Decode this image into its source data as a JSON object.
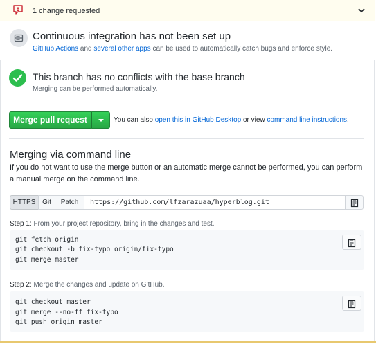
{
  "review_bar": {
    "icon": "review-request-icon",
    "text": "1 change requested",
    "chevron": "chevron-down-icon"
  },
  "ci": {
    "icon": "server-icon",
    "title": "Continuous integration has not been set up",
    "link1": "GitHub Actions",
    "mid1": " and ",
    "link2": "several other apps",
    "rest": " can be used to automatically catch bugs and enforce style."
  },
  "conflicts": {
    "icon": "check-icon",
    "title": "This branch has no conflicts with the base branch",
    "desc": "Merging can be performed automatically."
  },
  "merge": {
    "button_label": "Merge pull request",
    "caret": "caret-down-icon",
    "also_prefix": "You can also ",
    "desktop_link": "open this in GitHub Desktop",
    "or_view": " or view ",
    "cli_link": "command line instructions",
    "period": "."
  },
  "cli": {
    "title": "Merging via command line",
    "desc": "If you do not want to use the merge button or an automatic merge cannot be performed, you can perform a manual merge on the command line.",
    "protocols": [
      "HTTPS",
      "Git",
      "Patch"
    ],
    "selected_protocol": "HTTPS",
    "clone_url": "https://github.com/lfzarazuaa/hyperblog.git",
    "step1_label": "Step 1:",
    "step1_text": " From your project repository, bring in the changes and test.",
    "step1_code": [
      "git fetch origin",
      "git checkout -b fix-typo origin/fix-typo",
      "git merge master"
    ],
    "step2_label": "Step 2:",
    "step2_text": " Merge the changes and update on GitHub.",
    "step2_code": [
      "git checkout master",
      "git merge --no-ff fix-typo",
      "git push origin master"
    ]
  },
  "colors": {
    "accent_green": "#2cbe4e",
    "link_blue": "#0366d6",
    "review_red": "#cb2431",
    "bar_yellow": "#fffdef"
  }
}
